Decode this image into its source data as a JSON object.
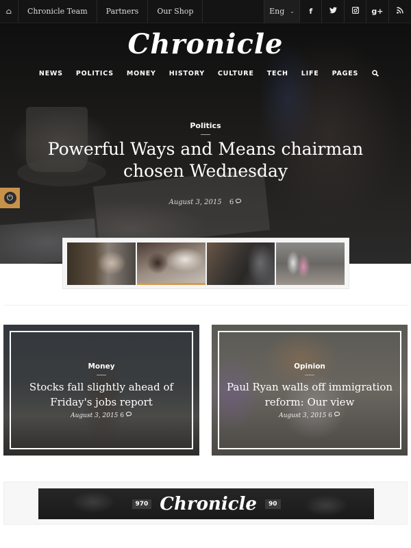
{
  "topbar": {
    "home_icon": "⌂",
    "links": [
      "Chronicle Team",
      "Partners",
      "Our Shop"
    ],
    "language": "Eng",
    "language_chevron": "⌄",
    "social": [
      {
        "name": "facebook",
        "glyph": "f"
      },
      {
        "name": "twitter",
        "glyph": "🐦"
      },
      {
        "name": "instagram",
        "glyph": "◙"
      },
      {
        "name": "google-plus",
        "glyph": "g+"
      },
      {
        "name": "rss",
        "glyph": "⟟"
      }
    ]
  },
  "header": {
    "logo": "Chronicle",
    "nav": [
      "NEWS",
      "POLITICS",
      "MONEY",
      "HISTORY",
      "CULTURE",
      "TECH",
      "LIFE",
      "PAGES"
    ],
    "search_icon": "🔍"
  },
  "hero": {
    "category": "Politics",
    "title": "Powerful Ways and Means chairman chosen Wednesday",
    "date": "August 3, 2015",
    "comments": "6",
    "comment_icon": "💬"
  },
  "settings": {
    "icon": "⏻"
  },
  "slider": {
    "active_index": 1,
    "thumbs": [
      "thumbnail-1",
      "thumbnail-2",
      "thumbnail-3",
      "thumbnail-4"
    ],
    "accent_color": "#d49a4a"
  },
  "cards": [
    {
      "category": "Money",
      "title": "Stocks fall slightly ahead of Friday's jobs report",
      "date": "August 3, 2015",
      "comments": "6"
    },
    {
      "category": "Opinion",
      "title": "Paul Ryan walls off immigration reform: Our view",
      "date": "August 3, 2015",
      "comments": "6"
    }
  ],
  "ad": {
    "width_label": "970",
    "logo": "Chronicle",
    "height_label": "90"
  },
  "colors": {
    "topbar_bg": "#141414",
    "settings_accent": "#c8914a"
  }
}
